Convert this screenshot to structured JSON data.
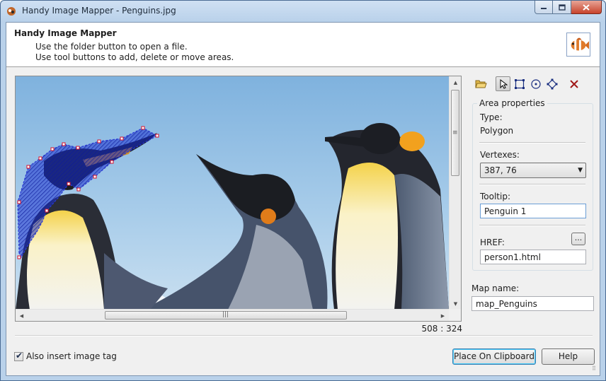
{
  "window": {
    "title": "Handy Image Mapper - Penguins.jpg"
  },
  "header": {
    "title": "Handy Image Mapper",
    "line1": "Use the folder button to open a file.",
    "line2": "Use tool buttons to add, delete or move areas."
  },
  "toolbar": {
    "icons": [
      "open-folder-icon",
      "pointer-icon",
      "rectangle-icon",
      "circle-icon",
      "polygon-icon",
      "delete-x-icon"
    ],
    "active_tool": "pointer"
  },
  "area_properties": {
    "legend": "Area properties",
    "type_label": "Type:",
    "type_value": "Polygon",
    "vertexes_label": "Vertexes:",
    "vertexes_selected": "387, 76",
    "tooltip_label": "Tooltip:",
    "tooltip_value": "Penguin 1",
    "href_label": "HREF:",
    "href_browse": "...",
    "href_value": "person1.html"
  },
  "map": {
    "label": "Map name:",
    "value": "map_Penguins"
  },
  "status": {
    "coords": "508 : 324"
  },
  "options": {
    "insert_image_tag_label": "Also insert image tag",
    "insert_image_tag_checked": true
  },
  "buttons": {
    "clipboard": "Place On Clipboard",
    "help": "Help"
  },
  "colors": {
    "accent": "#3c7fb1",
    "polygon_outline": "#2b3bd6",
    "polygon_fill": "#1a2fd0",
    "vertex_handle": "#d8102a",
    "delete_icon": "#a01818"
  }
}
